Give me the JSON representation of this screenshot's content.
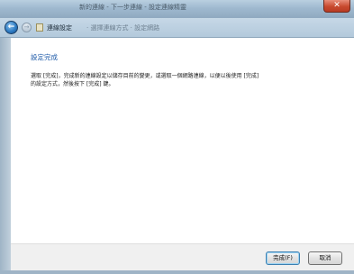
{
  "window": {
    "title": "新的連線 - 下一步連線 - 設定連線精靈"
  },
  "nav": {
    "title": "連線設定",
    "subtitle": "· 選擇連線方式 · 設定網路",
    "back_icon": "back-arrow-icon",
    "forward_icon": "forward-arrow-icon"
  },
  "content": {
    "heading": "設定完成",
    "line1": "選取 [完成]，完成新的連線設定以儲存目前的變更，或選取一個網路連線，以便以後使用 [完成]",
    "line2": "的設定方式，然後按下 [完成] 鍵。"
  },
  "footer": {
    "next_label": "完成(F)",
    "cancel_label": "取消"
  },
  "colors": {
    "heading": "#1e5aa8",
    "close": "#c84a2f"
  }
}
